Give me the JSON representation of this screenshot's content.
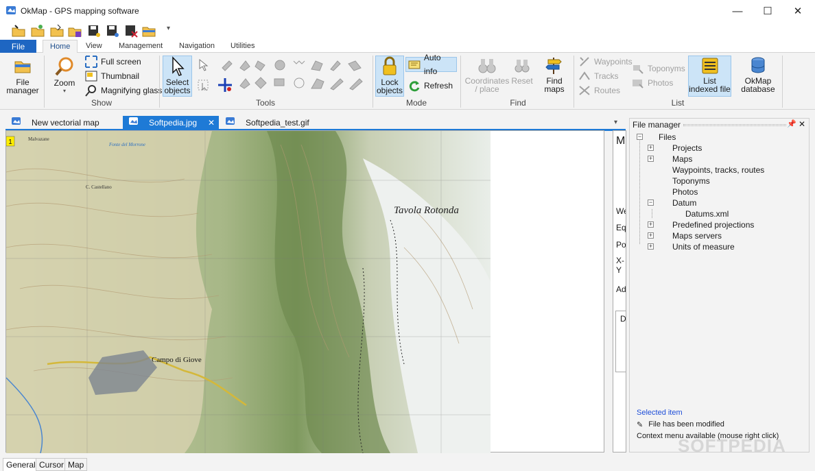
{
  "window": {
    "title": "OkMap - GPS mapping software"
  },
  "window_controls": {
    "minimize": "—",
    "maximize": "☐",
    "close": "✕"
  },
  "ribbon_tabs": [
    "File",
    "Home",
    "View",
    "Management",
    "Navigation",
    "Utilities"
  ],
  "ribbon": {
    "file_manager": "File\nmanager",
    "zoom": "Zoom",
    "full_screen": "Full screen",
    "thumbnail": "Thumbnail",
    "magnifying_glass": "Magnifying glass",
    "show_group": "Show",
    "select_objects": "Select\nobjects",
    "tools_group": "Tools",
    "lock_objects": "Lock\nobjects",
    "auto_info": "Auto info",
    "refresh": "Refresh",
    "mode_group": "Mode",
    "coordinates_place": "Coordinates\n/ place",
    "reset": "Reset",
    "find_maps": "Find\nmaps",
    "find_group": "Find",
    "waypoints": "Waypoints",
    "tracks": "Tracks",
    "routes": "Routes",
    "toponyms": "Toponyms",
    "photos": "Photos",
    "list_indexed_file": "List\nindexed file",
    "okmap_database": "OkMap\ndatabase",
    "list_group": "List"
  },
  "doc_tabs": [
    "New vectorial map",
    "Softpedia.jpg",
    "Softpedia_test.gif"
  ],
  "map": {
    "corner_label": "1",
    "place_labels": [
      "Tavola Rotonda",
      "Campo di Giove",
      "Malvazane",
      "C. Castellano",
      "Fonte del Morrone"
    ]
  },
  "side_panel_fragments": [
    "M",
    "We",
    "Eq",
    "Po",
    "X-Y",
    "Ad",
    "D"
  ],
  "file_manager": {
    "title": "File manager",
    "tree": [
      {
        "label": "Files",
        "level": 0,
        "expander": "−"
      },
      {
        "label": "Projects",
        "level": 1,
        "expander": "+"
      },
      {
        "label": "Maps",
        "level": 1,
        "expander": "+"
      },
      {
        "label": "Waypoints, tracks, routes",
        "level": 1,
        "expander": ""
      },
      {
        "label": "Toponyms",
        "level": 1,
        "expander": ""
      },
      {
        "label": "Photos",
        "level": 1,
        "expander": ""
      },
      {
        "label": "Datum",
        "level": 1,
        "expander": "−"
      },
      {
        "label": "Datums.xml",
        "level": 2,
        "expander": ""
      },
      {
        "label": "Predefined projections",
        "level": 1,
        "expander": "+"
      },
      {
        "label": "Maps servers",
        "level": 1,
        "expander": "+"
      },
      {
        "label": "Units of measure",
        "level": 1,
        "expander": "+"
      }
    ],
    "selected_item": "Selected item",
    "modified": "File has been modified",
    "context_menu": "Context menu available (mouse right click)"
  },
  "bottom_tabs": [
    "General",
    "Cursor",
    "Map"
  ],
  "watermark": "SOFTPEDIA"
}
